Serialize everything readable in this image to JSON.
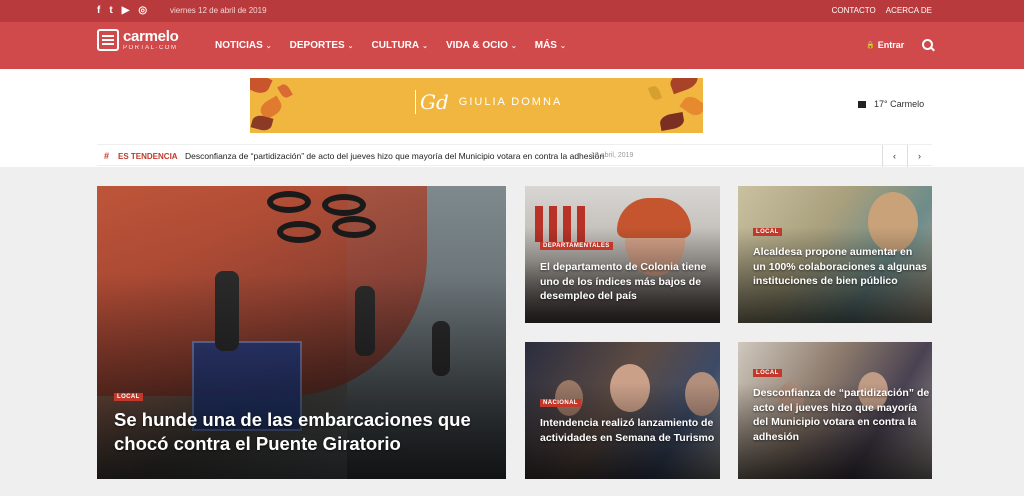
{
  "topbar": {
    "social": [
      "f",
      "t",
      "▶",
      "◎"
    ],
    "date": "viernes 12 de abril de 2019",
    "links": [
      "CONTACTO",
      "ACERCA DE"
    ]
  },
  "nav": {
    "logo_main": "carmelo",
    "logo_sub": "PORTAL·COM",
    "items": [
      {
        "label": "NOTICIAS",
        "chevron": "⌄"
      },
      {
        "label": "DEPORTES",
        "chevron": "⌄"
      },
      {
        "label": "CULTURA",
        "chevron": "⌄"
      },
      {
        "label": "VIDA & OCIO",
        "chevron": "⌄"
      },
      {
        "label": "MÁS",
        "chevron": "⌄"
      }
    ],
    "login_label": "Entrar",
    "login_icon": "🔒"
  },
  "ad": {
    "monogram": "Gd",
    "brand": "GIULIA DOMNA"
  },
  "weather": {
    "text": "17° Carmelo"
  },
  "ticker": {
    "hash": "#",
    "label": "ES TENDENCIA",
    "headline": "Desconfianza de “partidización” de acto del jueves hizo que mayoría del Municipio votara en contra la adhesión",
    "date": "10 abril, 2019",
    "prev": "‹",
    "next": "›"
  },
  "articles": [
    {
      "id": "main",
      "category": "LOCAL",
      "title": "Se hunde una de las embarcaciones que chocó contra el Puente Giratorio"
    },
    {
      "id": "a",
      "category": "DEPARTAMENTALES",
      "title": "El departamento de Colonia tiene uno de los índices más bajos de desempleo del país"
    },
    {
      "id": "b",
      "category": "LOCAL",
      "title": "Alcaldesa propone aumentar en un 100% colaboraciones a algunas instituciones de bien público"
    },
    {
      "id": "c",
      "category": "NACIONAL",
      "title": "Intendencia realizó lanzamiento de actividades en Semana de Turismo"
    },
    {
      "id": "d",
      "category": "LOCAL",
      "title": "Desconfianza de “partidización” de acto del jueves hizo que mayoría del Municipio votara en contra la adhesión"
    }
  ],
  "colors": {
    "topbar": "#b93a3c",
    "nav": "#d04a4b",
    "badge": "#c0392b",
    "ad_bg": "#f1b63f"
  }
}
